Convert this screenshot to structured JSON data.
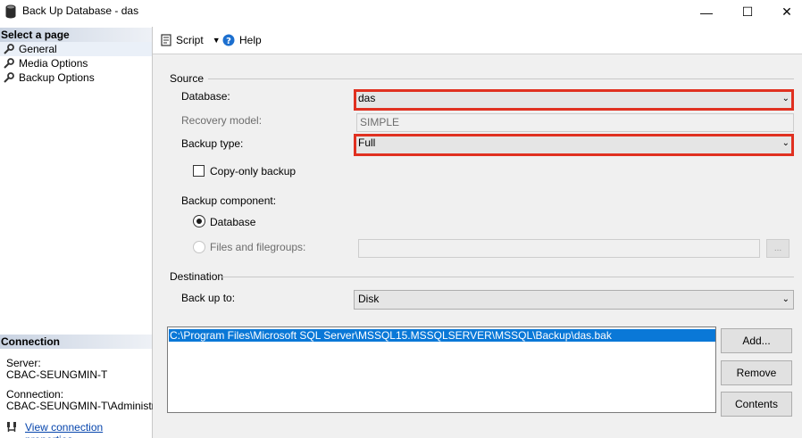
{
  "window": {
    "title": "Back Up Database - das",
    "minimize_glyph": "—",
    "maximize_glyph": "☐",
    "close_glyph": "✕"
  },
  "left": {
    "select_page_header": "Select a page",
    "pages": [
      {
        "label": "General",
        "selected": true,
        "icon": "wrench-icon"
      },
      {
        "label": "Media Options",
        "selected": false,
        "icon": "wrench-icon"
      },
      {
        "label": "Backup Options",
        "selected": false,
        "icon": "wrench-icon"
      }
    ],
    "connection_header": "Connection",
    "server_label": "Server:",
    "server_value": "CBAC-SEUNGMIN-T",
    "connection_label": "Connection:",
    "connection_value": "CBAC-SEUNGMIN-T\\Administrator",
    "view_properties_link": "View connection properties"
  },
  "toolbar": {
    "script_label": "Script",
    "help_label": "Help"
  },
  "source": {
    "group_label": "Source",
    "database_label": "Database:",
    "database_value": "das",
    "recovery_model_label": "Recovery model:",
    "recovery_model_value": "SIMPLE",
    "backup_type_label": "Backup type:",
    "backup_type_value": "Full",
    "copy_only_label": "Copy-only backup",
    "copy_only_checked": false,
    "backup_component_label": "Backup component:",
    "component_database_label": "Database",
    "component_files_label": "Files and filegroups:",
    "selected_component": "Database",
    "ellipsis_label": "..."
  },
  "destination": {
    "group_label": "Destination",
    "back_up_to_label": "Back up to:",
    "back_up_to_value": "Disk",
    "paths": [
      "C:\\Program Files\\Microsoft SQL Server\\MSSQL15.MSSQLSERVER\\MSSQL\\Backup\\das.bak"
    ],
    "add_button": "Add...",
    "remove_button": "Remove",
    "contents_button": "Contents"
  },
  "colors": {
    "highlight_border": "#e03020",
    "selected_row": "#0a78d7",
    "link": "#0645ad"
  }
}
